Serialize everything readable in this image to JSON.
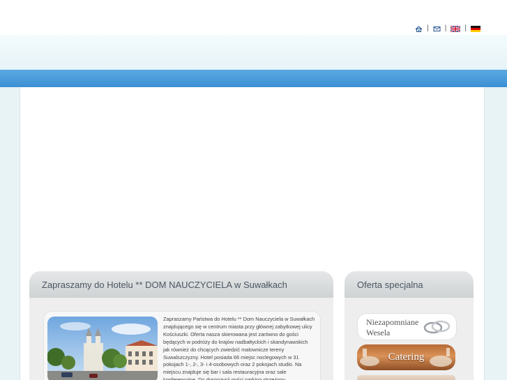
{
  "header": {
    "links": [
      {
        "name": "home",
        "icon": "home-icon"
      },
      {
        "name": "contact",
        "icon": "envelope-icon"
      },
      {
        "name": "english",
        "icon": "uk-flag-icon"
      },
      {
        "name": "german",
        "icon": "german-flag-icon"
      }
    ],
    "separator": "|"
  },
  "colors": {
    "nav_bar": "#4a9edc",
    "page_background": "#e8f3f5",
    "panel_header": "#d6d9db",
    "panel_title_text": "#4a5560"
  },
  "main": {
    "title": "Zapraszamy do Hotelu ** DOM NAUCZYCIELA w Suwałkach",
    "intro_text": "Zapraszamy Państwa do Hotelu ** Dom Nauczyciela w Suwałkach znajdującego się w centrum miasta przy głównej zabytkowej ulicy Kościuszki. Oferta nasza skierowana jest zarówno do gości będących w podróży do krajów nadbałtyckich i skandynawskich jak również do chcących zwiedzić malownicze tereny Suwalszczyzny. Hotel posiada 66 miejsc noclegowych w 31 pokojach 1-, 2-, 3- i 4-osobowych oraz 2 pokojach studio. Na miejscu znajduje się bar i sala restauracyjna oraz sale konferencyjne. Do dyspozycji gości parking strzeżony."
  },
  "sidebar": {
    "title": "Oferta specjalna",
    "offers": [
      {
        "line1": "Niezapomniane",
        "line2": "Wesela",
        "icon": "wedding-rings-icon"
      },
      {
        "line1": "Catering",
        "icon": "catering-icon"
      }
    ]
  }
}
